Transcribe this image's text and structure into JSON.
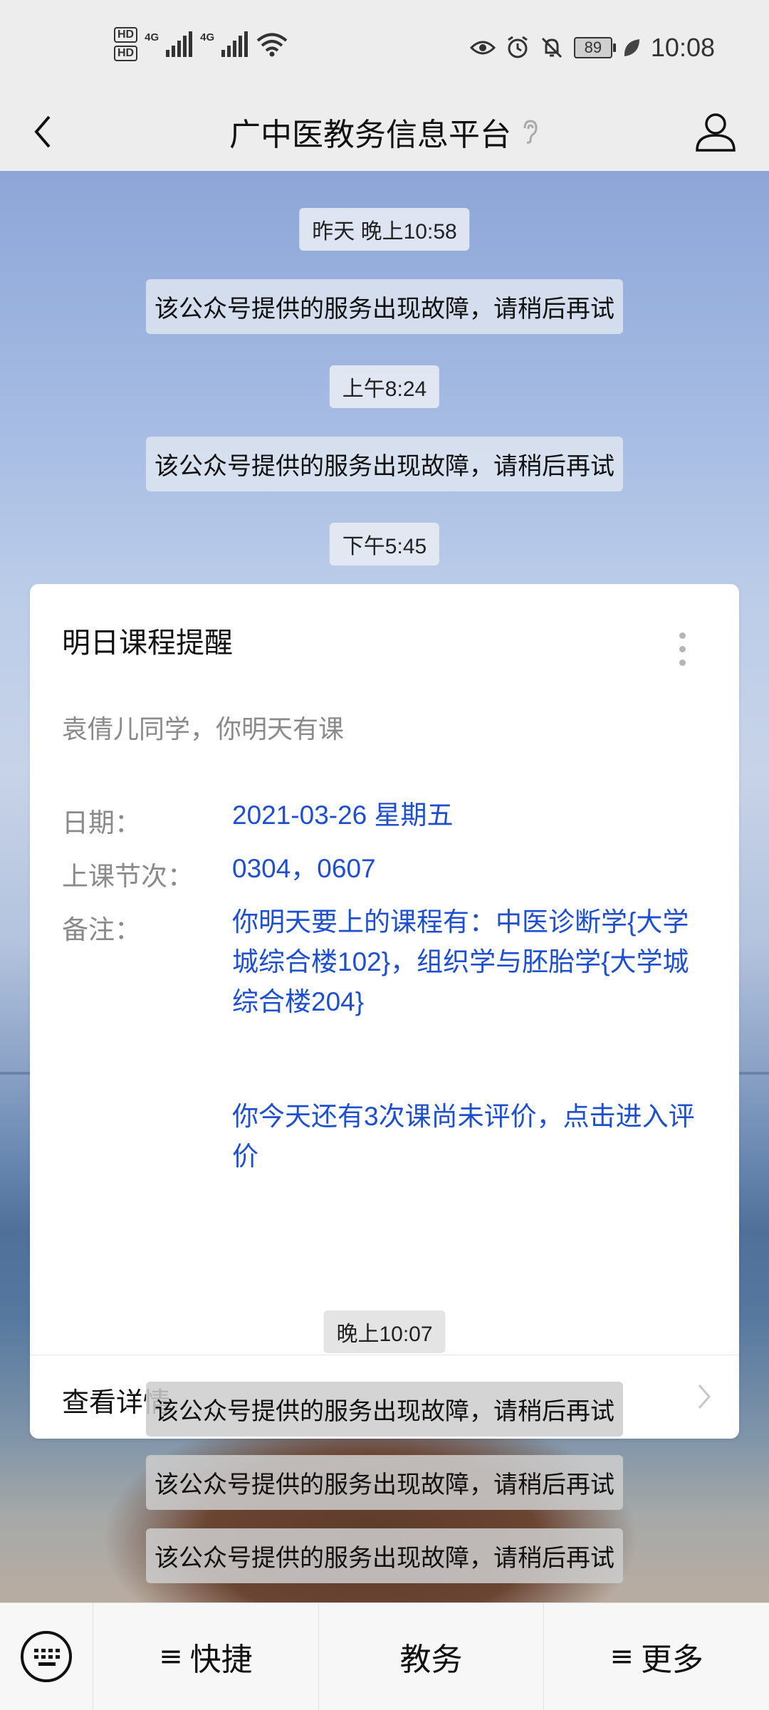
{
  "status_bar": {
    "hd1": "HD",
    "hd2": "HD",
    "sim1_label": "4G",
    "sim2_label": "4G",
    "battery": "89",
    "time": "10:08"
  },
  "header": {
    "title": "广中医教务信息平台"
  },
  "timeline": [
    {
      "time": "昨天 晚上10:58",
      "message": "该公众号提供的服务出现故障，请稍后再试"
    },
    {
      "time": "上午8:24",
      "message": "该公众号提供的服务出现故障，请稍后再试"
    },
    {
      "time": "下午5:45"
    },
    {
      "time": "晚上10:07",
      "messages": [
        "该公众号提供的服务出现故障，请稍后再试",
        "该公众号提供的服务出现故障，请稍后再试",
        "该公众号提供的服务出现故障，请稍后再试"
      ]
    }
  ],
  "card": {
    "title": "明日课程提醒",
    "subtitle": "袁倩儿同学，你明天有课",
    "date_label": "日期：",
    "date_value": "2021-03-26 星期五",
    "periods_label": "上课节次：",
    "periods_value": "0304，0607",
    "remark_label": "备注：",
    "remark_value": "你明天要上的课程有：中医诊断学{大学城综合楼102}，组织学与胚胎学{大学城综合楼204}",
    "remark_extra": "你今天还有3次课尚未评价，点击进入评价",
    "detail_link": "查看详情"
  },
  "menu": {
    "quick": "快捷",
    "academic": "教务",
    "more": "更多"
  },
  "colors": {
    "link_blue": "#1f4fd1",
    "muted_gray": "#8a8a8a"
  }
}
